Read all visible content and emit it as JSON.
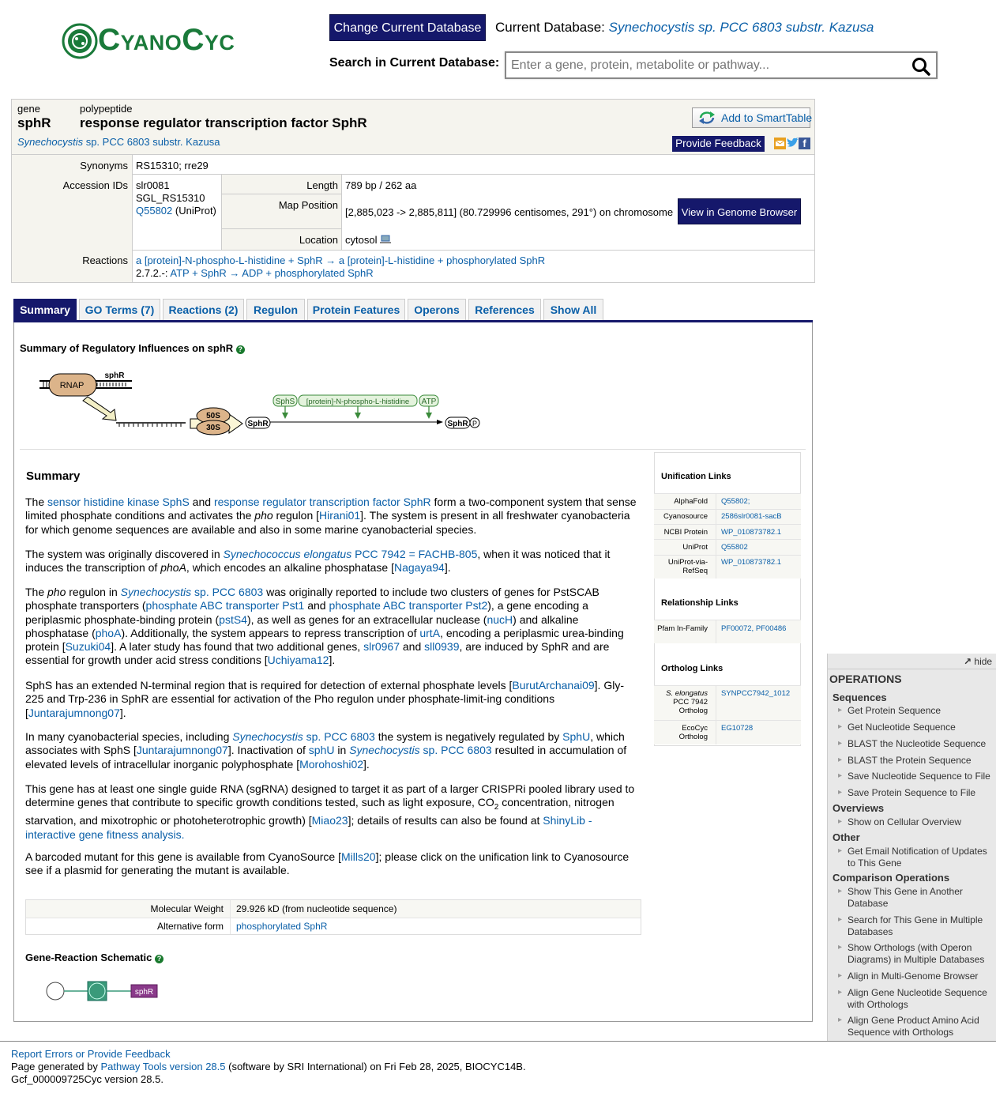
{
  "header": {
    "logo_text": "CyanoCyc",
    "change_db_label": "Change Current Database",
    "current_db_label": "Current Database:",
    "current_db_value": "Synechocystis sp. PCC 6803 substr. Kazusa",
    "search_label": "Search in Current Database:",
    "search_placeholder": "Enter a gene, protein, metabolite or pathway..."
  },
  "gene": {
    "kind": "gene",
    "name": "sphR",
    "poly_kind": "polypeptide",
    "poly_name": "response regulator transcription factor SphR",
    "organism_italic": "Synechocystis",
    "organism_rest": " sp. PCC 6803 substr. Kazusa",
    "add_smarttable": "Add to SmartTable",
    "provide_feedback": "Provide Feedback"
  },
  "attributes": {
    "synonyms_label": "Synonyms",
    "synonyms_value": "RS15310; rre29",
    "accession_label": "Accession IDs",
    "accession_1": "slr0081",
    "accession_2": "SGL_RS15310",
    "accession_3_link": "Q55802",
    "accession_3_rest": " (UniProt)",
    "length_label": "Length",
    "length_value": "789 bp / 262 aa",
    "map_label": "Map Position",
    "map_value": "[2,885,023 -> 2,885,811] (80.729996 centisomes, 291°) on chromosome",
    "genome_browser": "View in Genome Browser",
    "location_label": "Location",
    "location_value": "cytosol",
    "reactions_label": "Reactions",
    "reaction_1": "a [protein]-N-phospho-L-histidine + SphR → a [protein]-L-histidine + phosphorylated SphR",
    "reaction_2_prefix": "2.7.2.-:",
    "reaction_2": "ATP + SphR → ADP + phosphorylated SphR"
  },
  "tabs": [
    {
      "label": "Summary",
      "active": true
    },
    {
      "label": "GO Terms (7)"
    },
    {
      "label": "Reactions (2)"
    },
    {
      "label": "Regulon"
    },
    {
      "label": "Protein Features"
    },
    {
      "label": "Operons"
    },
    {
      "label": "References"
    },
    {
      "label": "Show All"
    }
  ],
  "regulation": {
    "title": "Summary of Regulatory Influences on sphR",
    "rnap": "RNAP",
    "gene": "sphR",
    "ribosome_50": "50S",
    "ribosome_30": "30S",
    "sphr_box": "SphR",
    "reg_sphs": "SphS",
    "reg_phospho": "[protein]-N-phospho-L-histidine",
    "reg_atp": "ATP",
    "product": "SphR",
    "product_p": "P"
  },
  "summary": {
    "heading": "Summary",
    "p1": [
      "The ",
      {
        "l": "sensor histidine kinase SphS"
      },
      " and ",
      {
        "l": "response regulator transcription factor SphR"
      },
      " form a two-component system that sense limited phosphate conditions and activates the ",
      {
        "i": "pho"
      },
      " regulon [",
      {
        "l": "Hirani01"
      },
      "]. The system is present in all freshwater cyanobacteria for which genome sequences are available and also in some marine cyanobacterial species."
    ],
    "p2": [
      "The system was originally discovered in ",
      {
        "li": "Synechococcus elongatus"
      },
      {
        "l": " PCC 7942 = FACHB-805"
      },
      ", when it was noticed that it induces the transcription of ",
      {
        "i": "phoA"
      },
      ", which encodes an alkaline phosphatase [",
      {
        "l": "Nagaya94"
      },
      "]."
    ],
    "p3": [
      "The ",
      {
        "i": "pho"
      },
      " regulon in ",
      {
        "li": "Synechocystis"
      },
      {
        "l": " sp. PCC 6803"
      },
      " was originally reported to include two clusters of genes for PstSCAB phosphate transporters (",
      {
        "l": "phosphate ABC transporter Pst1"
      },
      " and ",
      {
        "l": "phosphate ABC transporter Pst2"
      },
      "), a gene encoding a periplasmic phosphate-binding protein (",
      {
        "l": "pstS4"
      },
      "), as well as genes for an extracellular nuclease (",
      {
        "l": "nucH"
      },
      ") and alkaline phosphatase (",
      {
        "l": "phoA"
      },
      "). Additionally, the system appears to repress transcription of ",
      {
        "l": "urtA"
      },
      ", encoding a periplasmic urea-binding protein [",
      {
        "l": "Suzuki04"
      },
      "]. A later study has found that two additional genes, ",
      {
        "l": "slr0967"
      },
      " and ",
      {
        "l": "sll0939"
      },
      ", are induced by SphR and are essential for growth under acid stress conditions [",
      {
        "l": "Uchiyama12"
      },
      "]."
    ],
    "p4": [
      "SphS has an extended N-terminal region that is required for detection of external phosphate levels [",
      {
        "l": "BurutArchanai09"
      },
      "]. Gly-225 and Trp-236 in SphR are essential for activation of the Pho regulon under phosphate-limit-ing conditions [",
      {
        "l": "Juntarajumnong07"
      },
      "]."
    ],
    "p5": [
      "In many cyanobacterial species, including ",
      {
        "li": "Synechocystis"
      },
      {
        "l": " sp. PCC 6803"
      },
      " the system is negatively regulated by ",
      {
        "l": "SphU"
      },
      ", which associates with SphS [",
      {
        "l": "Juntarajumnong07"
      },
      "]. Inactivation of ",
      {
        "l": "sphU"
      },
      " in ",
      {
        "li": "Synechocystis"
      },
      {
        "l": " sp. PCC 6803"
      },
      " resulted in accumulation of elevated levels of intracellular inorganic polyphosphate [",
      {
        "l": "Morohoshi02"
      },
      "]."
    ],
    "p6": [
      "This gene has at least one single guide RNA (sgRNA) designed to target it as part of a larger CRISPRi pooled library used to determine genes that contribute to specific growth conditions tested, such as light exposure, CO",
      {
        "sub": "2"
      },
      " concentration, nitrogen starvation, and mixotrophic or photoheterotrophic growth) [",
      {
        "l": "Miao23"
      },
      "]; details of results can also be found at ",
      {
        "l": "ShinyLib - interactive gene fitness analysis."
      }
    ],
    "p7": [
      "A barcoded mutant for this gene is available from CyanoSource [",
      {
        "l": "Mills20"
      },
      "]; please click on the unification link to Cyanosource see if a plasmid for generating the mutant is available."
    ]
  },
  "links": {
    "unification_title": "Unification Links",
    "unification": [
      {
        "label": "AlphaFold",
        "value": "Q55802;"
      },
      {
        "label": "Cyanosource",
        "value": "2586slr0081-sacB"
      },
      {
        "label": "NCBI Protein",
        "value": "WP_010873782.1"
      },
      {
        "label": "UniProt",
        "value": "Q55802"
      },
      {
        "label": "UniProt-via-RefSeq",
        "value": "WP_010873782.1"
      }
    ],
    "relationship_title": "Relationship Links",
    "relationship_label": "Pfam In-Family",
    "relationship_value": "PF00072, PF00486",
    "ortholog_title": "Ortholog Links",
    "ortholog_1_label_i": "S. elongatus",
    "ortholog_1_label": "PCC 7942 Ortholog",
    "ortholog_1_value": "SYNPCC7942_1012",
    "ortholog_2_label": "EcoCyc Ortholog",
    "ortholog_2_value": "EG10728"
  },
  "properties": {
    "mw_label": "Molecular Weight",
    "mw_value": "29.926 kD (from nucleotide sequence)",
    "alt_label": "Alternative form",
    "alt_value": "phosphorylated SphR"
  },
  "schematic": {
    "title": "Gene-Reaction Schematic",
    "gene_label": "sphR"
  },
  "operations": {
    "hide": "hide",
    "title": "OPERATIONS",
    "sections": [
      {
        "title": "Sequences",
        "items": [
          "Get Protein Sequence",
          "Get Nucleotide Sequence",
          "BLAST the Nucleotide Sequence",
          "BLAST the Protein Sequence",
          "Save Nucleotide Sequence to File",
          "Save Protein Sequence to File"
        ]
      },
      {
        "title": "Overviews",
        "items": [
          "Show on Cellular Overview"
        ]
      },
      {
        "title": "Other",
        "items": [
          "Get Email Notification of Updates to This Gene"
        ]
      },
      {
        "title": "Comparison Operations",
        "items": [
          "Show This Gene in Another Database",
          "Search for This Gene in Multiple Databases",
          "Show Orthologs (with Operon Diagrams) in Multiple Databases",
          "Align in Multi-Genome Browser",
          "Align Gene Nucleotide Sequence with Orthologs",
          "Align Gene Product Amino Acid Sequence with Orthologs"
        ]
      }
    ]
  },
  "footer": {
    "report": "Report Errors or Provide Feedback",
    "generated_prefix": "Page generated by ",
    "generated_link": "Pathway Tools version 28.5",
    "generated_rest": " (software by SRI International) on Fri Feb 28, 2025, BIOCYC14B.",
    "version": "Gcf_000009725Cyc version 28.5."
  },
  "colors": {
    "brand": "#15186b",
    "link": "#0a5fa8",
    "logo": "#1a7a3a"
  }
}
